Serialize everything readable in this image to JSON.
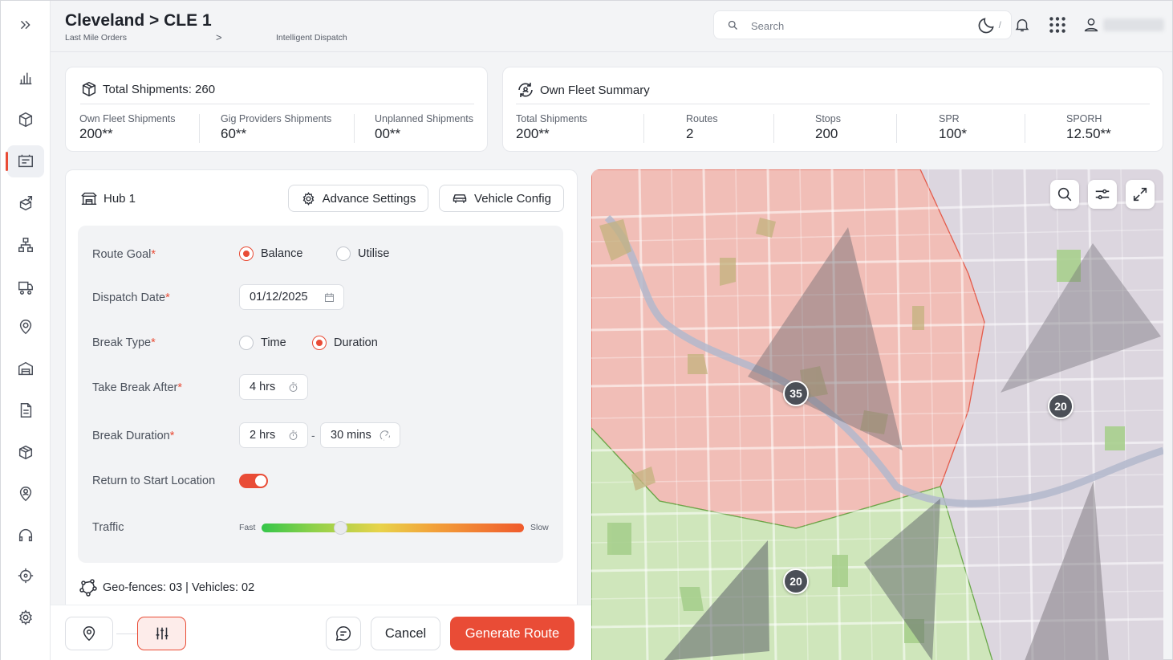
{
  "header": {
    "title": "Cleveland > CLE 1",
    "breadcrumb": [
      "Last Mile Orders",
      "Intelligent Dispatch"
    ],
    "breadcrumb_separator": ">",
    "search_placeholder": "Search",
    "search_shortcut": "/",
    "icons": [
      "moon-icon",
      "bell-icon",
      "grid-icon",
      "user-icon"
    ]
  },
  "sidebar": {
    "toggle_icon": "double-chevron-right-icon",
    "items": [
      {
        "icon": "bar-chart-icon"
      },
      {
        "icon": "package-icon"
      },
      {
        "icon": "dispatch-board-icon",
        "active": true
      },
      {
        "icon": "box-arrow-icon"
      },
      {
        "icon": "hierarchy-icon"
      },
      {
        "icon": "truck-icon"
      },
      {
        "icon": "location-pin-icon"
      },
      {
        "icon": "warehouse-icon"
      },
      {
        "icon": "document-icon"
      },
      {
        "icon": "boxes-icon"
      },
      {
        "icon": "user-pin-icon"
      },
      {
        "icon": "headset-icon"
      },
      {
        "icon": "target-icon"
      },
      {
        "icon": "gear-icon"
      }
    ]
  },
  "total_shipments": {
    "title": "Total Shipments: 260",
    "metrics": [
      {
        "label": "Own Fleet Shipments",
        "value": "200**"
      },
      {
        "label": "Gig Providers Shipments",
        "value": "60**"
      },
      {
        "label": "Unplanned Shipments",
        "value": "00**"
      }
    ]
  },
  "fleet_summary": {
    "title": "Own Fleet Summary",
    "metrics": [
      {
        "label": "Total Shipments",
        "value": "200**"
      },
      {
        "label": "Routes",
        "value": "2"
      },
      {
        "label": "Stops",
        "value": "200"
      },
      {
        "label": "SPR",
        "value": "100*"
      },
      {
        "label": "SPORH",
        "value": "12.50**"
      }
    ]
  },
  "hub": {
    "name": "Hub 1",
    "advance_settings": "Advance Settings",
    "vehicle_config": "Vehicle Config"
  },
  "form": {
    "required_mark": "*",
    "route_goal": {
      "label": "Route Goal",
      "options": [
        "Balance",
        "Utilise"
      ],
      "selected": "Balance"
    },
    "dispatch_date": {
      "label": "Dispatch Date",
      "value": "01/12/2025"
    },
    "break_type": {
      "label": "Break Type",
      "options": [
        "Time",
        "Duration"
      ],
      "selected": "Duration"
    },
    "take_break_after": {
      "label": "Take Break After",
      "value": "4 hrs"
    },
    "break_duration": {
      "label": "Break Duration",
      "hours": "2 hrs",
      "separator": "-",
      "minutes": "30 mins"
    },
    "return_to_start": {
      "label": "Return to Start Location",
      "on": true
    },
    "traffic": {
      "label": "Traffic",
      "min_label": "Fast",
      "max_label": "Slow",
      "level": 0.3
    }
  },
  "geo_summary": "Geo-fences: 03 | Vehicles: 02",
  "footer": {
    "cancel": "Cancel",
    "generate": "Generate Route"
  },
  "map": {
    "clusters": [
      "35",
      "20",
      "20"
    ],
    "controls": [
      "search-icon",
      "filter-sliders-icon",
      "expand-icon"
    ],
    "colors": {
      "zone_red": "#f0b8b0",
      "zone_green": "#c9e4b4",
      "zone_purple": "#d8d1dc"
    }
  },
  "colors": {
    "accent": "#e94c36"
  }
}
